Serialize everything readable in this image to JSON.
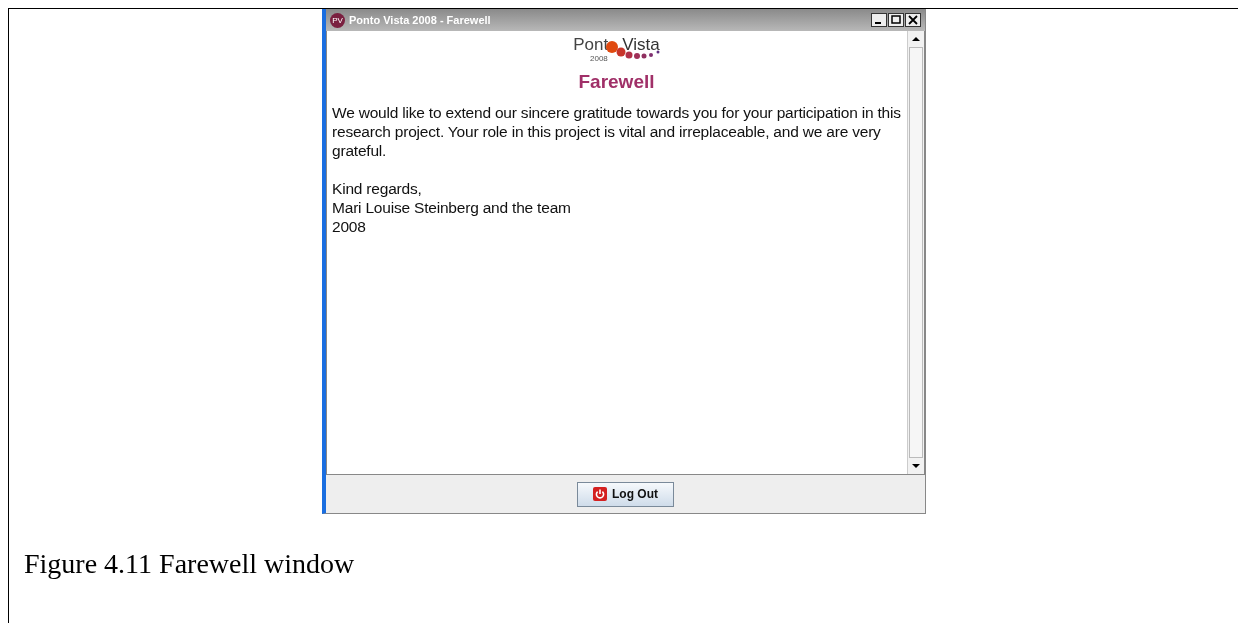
{
  "window": {
    "title": "Ponto Vista 2008 - Farewell",
    "app_badge": "PV"
  },
  "logo": {
    "left": "Pont",
    "right": "Vista",
    "year": "2008"
  },
  "heading": "Farewell",
  "message": "We would like to extend our sincere gratitude towards you for your participation in this research project. Your role in this project is vital and irreplaceable, and we are very grateful.",
  "signature": [
    "Kind regards,",
    "Mari Louise Steinberg and the team",
    "2008"
  ],
  "button": {
    "label": "Log Out"
  },
  "caption": "Figure 4.11 Farewell window"
}
